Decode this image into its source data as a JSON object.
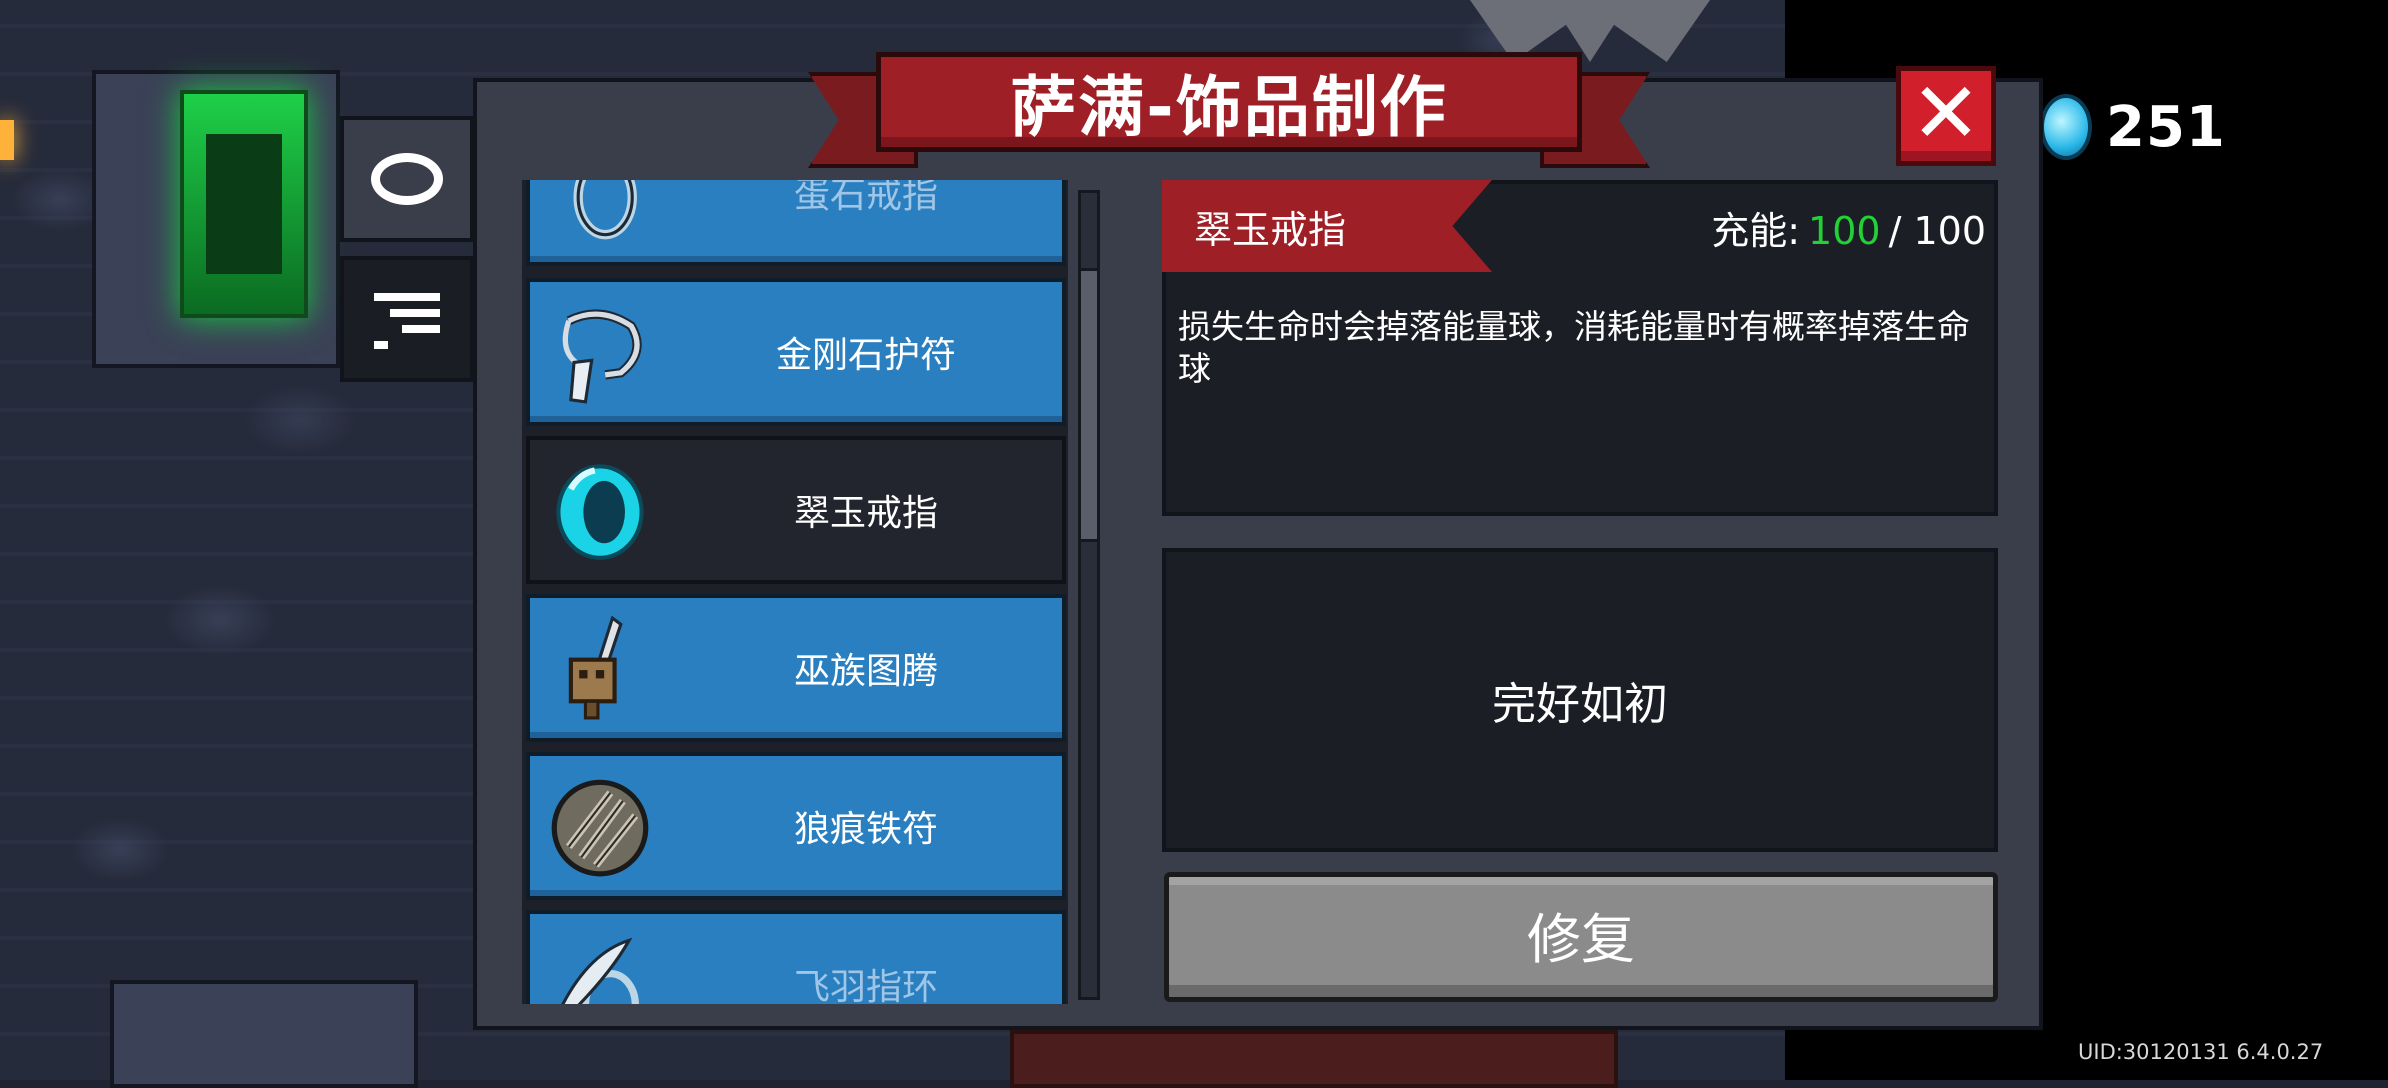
{
  "header": {
    "title": "萨满-饰品制作",
    "close_label": "✕"
  },
  "currency": {
    "value": "251",
    "icon": "blue-gem-icon"
  },
  "side_tabs": [
    {
      "name": "accessory-tab",
      "icon": "ring-icon",
      "active": true
    },
    {
      "name": "filter-tab",
      "icon": "filter-icon",
      "active": false
    }
  ],
  "items": [
    {
      "label": "蛋石戒指",
      "icon": "stone-ring-icon",
      "selected": false,
      "partial": true
    },
    {
      "label": "金刚石护符",
      "icon": "diamond-amulet-icon",
      "selected": false
    },
    {
      "label": "翠玉戒指",
      "icon": "jade-ring-icon",
      "selected": true
    },
    {
      "label": "巫族图腾",
      "icon": "totem-icon",
      "selected": false
    },
    {
      "label": "狼痕铁符",
      "icon": "iron-charm-icon",
      "selected": false
    },
    {
      "label": "飞羽指环",
      "icon": "feather-ring-icon",
      "selected": false,
      "partial": true
    }
  ],
  "detail": {
    "name": "翠玉戒指",
    "energy_label": "充能:",
    "energy_current": "100",
    "energy_max": "/ 100",
    "description": "损失生命时会掉落能量球，消耗能量时有概率掉落生命球",
    "status": "完好如初",
    "repair_label": "修复"
  },
  "colors": {
    "item_blue": "#2a7fc0",
    "banner_red": "#9e1f26",
    "energy_green": "#22d135"
  },
  "footer": {
    "uid": "UID:30120131 6.4.0.27"
  }
}
